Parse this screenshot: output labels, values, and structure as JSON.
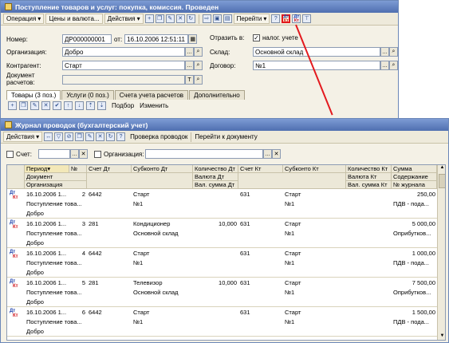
{
  "doc_window": {
    "title": "Поступление товаров и услуг: покупка, комиссия. Проведен",
    "toolbar": {
      "operation": "Операция",
      "prices": "Цены и валюта...",
      "actions": "Действия",
      "goto": "Перейти",
      "help": "?"
    },
    "fields": {
      "number_label": "Номер:",
      "number_value": "ДР000000001",
      "from_label": "от:",
      "date_value": "16.10.2006 12:51:11",
      "reflect_label": "Отразить в:",
      "tax_label": "налог. учете",
      "org_label": "Организация:",
      "org_value": "Добро",
      "warehouse_label": "Склад:",
      "warehouse_value": "Основной склад",
      "contractor_label": "Контрагент:",
      "contractor_value": "Старт",
      "contract_label": "Договор:",
      "contract_value": "№1",
      "settlement_label_1": "Документ",
      "settlement_label_2": "расчетов:"
    },
    "tabs": [
      "Товары (3 поз.)",
      "Услуги (0 поз.)",
      "Счета учета расчетов",
      "Дополнительно"
    ],
    "subtoolbar": {
      "selection": "Подбор",
      "change": "Изменить"
    }
  },
  "journal_window": {
    "title": "Журнал проводок (бухгалтерский учет)",
    "toolbar": {
      "actions": "Действия",
      "check": "Проверка проводок",
      "goto_doc": "Перейти к документу",
      "help": "?"
    },
    "filters": {
      "account_label": "Счет:",
      "org_label": "Организация:"
    },
    "headers": {
      "period": "Период",
      "num": "№",
      "document": "Документ",
      "organization": "Организация",
      "acc_dt": "Счет Дт",
      "subconto_dt": "Субконто Дт",
      "qty_dt": "Количество Дт",
      "currency_dt": "Валюта Дт",
      "cur_sum_dt": "Вал. сумма Дт",
      "acc_kt": "Счет Кт",
      "subconto_kt": "Субконто Кт",
      "qty_kt": "Количество Кт",
      "currency_kt": "Валюта Кт",
      "cur_sum_kt": "Вал. сумма Кт",
      "sum": "Сумма",
      "content": "Содержание",
      "journal_no": "№ журнала"
    },
    "icon_dt": "Дт",
    "icon_kt": "Кт",
    "rows": [
      {
        "period": "16.10.2006 1...",
        "num": "2",
        "doc": "Поступление това...",
        "org": "Добро",
        "acc_dt": "6442",
        "sub1": "Старт",
        "sub2": "№1",
        "qty_dt": "",
        "acc_kt": "631",
        "subk1": "Старт",
        "subk2": "№1",
        "sum": "250,00",
        "content": "ПДВ - подa..."
      },
      {
        "period": "16.10.2006 1...",
        "num": "3",
        "doc": "Поступление това...",
        "org": "Добро",
        "acc_dt": "281",
        "sub1": "Кондиционер",
        "sub2": "Основной склад",
        "qty_dt": "10,000",
        "acc_kt": "631",
        "subk1": "Старт",
        "subk2": "№1",
        "sum": "5 000,00",
        "content": "Оприбутков..."
      },
      {
        "period": "16.10.2006 1...",
        "num": "4",
        "doc": "Поступление това...",
        "org": "Добро",
        "acc_dt": "6442",
        "sub1": "Старт",
        "sub2": "№1",
        "qty_dt": "",
        "acc_kt": "631",
        "subk1": "Старт",
        "subk2": "№1",
        "sum": "1 000,00",
        "content": "ПДВ - подa..."
      },
      {
        "period": "16.10.2006 1...",
        "num": "5",
        "doc": "Поступление това...",
        "org": "Добро",
        "acc_dt": "281",
        "sub1": "Телевизор",
        "sub2": "Основной склад",
        "qty_dt": "10,000",
        "acc_kt": "631",
        "subk1": "Старт",
        "subk2": "№1",
        "sum": "7 500,00",
        "content": "Оприбутков..."
      },
      {
        "period": "16.10.2006 1...",
        "num": "6",
        "doc": "Поступление това...",
        "org": "Добро",
        "acc_dt": "6442",
        "sub1": "Старт",
        "sub2": "№1",
        "qty_dt": "",
        "acc_kt": "631",
        "subk1": "Старт",
        "subk2": "№1",
        "sum": "1 500,00",
        "content": "ПДВ - подa..."
      }
    ]
  },
  "colors": {
    "title_bar": "#4f6fb0",
    "highlight": "#e3191e",
    "window_bg": "#f4f1e6"
  }
}
